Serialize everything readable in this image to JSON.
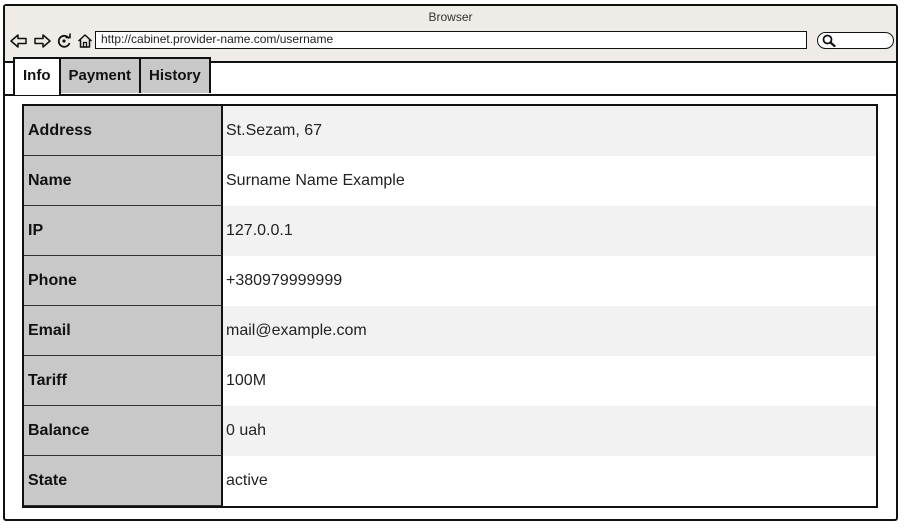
{
  "browser": {
    "title": "Browser",
    "url": "http://cabinet.provider-name.com/username",
    "icons": [
      "back-icon",
      "forward-icon",
      "reload-icon",
      "home-icon",
      "search-icon"
    ]
  },
  "tabs": [
    {
      "label": "Info",
      "active": true
    },
    {
      "label": "Payment",
      "active": false
    },
    {
      "label": "History",
      "active": false
    }
  ],
  "info": {
    "rows": [
      {
        "key": "Address",
        "value": "St.Sezam, 67"
      },
      {
        "key": "Name",
        "value": "Surname Name Example"
      },
      {
        "key": "IP",
        "value": "127.0.0.1"
      },
      {
        "key": "Phone",
        "value": "+380979999999"
      },
      {
        "key": "Email",
        "value": "mail@example.com"
      },
      {
        "key": "Tariff",
        "value": "100M"
      },
      {
        "key": "Balance",
        "value": "0 uah"
      },
      {
        "key": "State",
        "value": "active"
      }
    ]
  },
  "colors": {
    "label_column": "#c8c8c8",
    "row_alt": "#f2f2f2",
    "chrome": "#efebe6"
  }
}
